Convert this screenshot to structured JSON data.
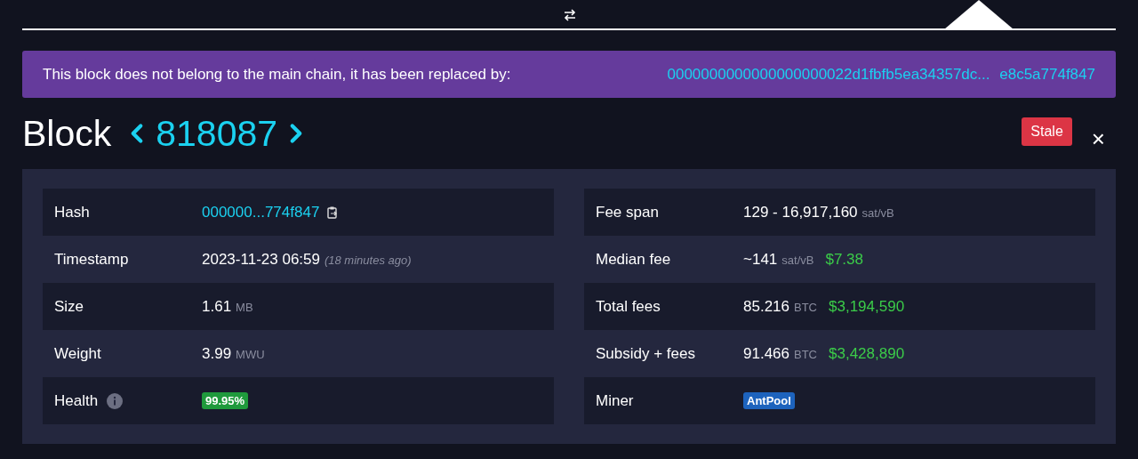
{
  "banner": {
    "message": "This block does not belong to the main chain, it has been replaced by:",
    "link": "0000000000000000000022d1fbfb5ea34357dc... e8c5a774f847"
  },
  "header": {
    "title": "Block",
    "number": "818087",
    "status": "Stale",
    "close": "×"
  },
  "columns": [
    {
      "rows": [
        {
          "label": "Hash",
          "kind": "hash",
          "value": "000000...774f847"
        },
        {
          "label": "Timestamp",
          "kind": "text",
          "value": "2023-11-23 06:59",
          "note": "(18 minutes ago)"
        },
        {
          "label": "Size",
          "kind": "text",
          "value": "1.61",
          "unit": "MB"
        },
        {
          "label": "Weight",
          "kind": "text",
          "value": "3.99",
          "unit": "MWU"
        },
        {
          "label": "Health",
          "kind": "badge",
          "info": true,
          "value": "99.95%",
          "color": "#1f9a3c"
        }
      ]
    },
    {
      "rows": [
        {
          "label": "Fee span",
          "kind": "text",
          "value": "129 - 16,917,160",
          "unit": "sat/vB"
        },
        {
          "label": "Median fee",
          "kind": "text",
          "value": "~141",
          "unit": "sat/vB",
          "fiat": "$7.38"
        },
        {
          "label": "Total fees",
          "kind": "text",
          "value": "85.216",
          "unit": "BTC",
          "fiat": "$3,194,590"
        },
        {
          "label": "Subsidy + fees",
          "kind": "text",
          "value": "91.466",
          "unit": "BTC",
          "fiat": "$3,428,890"
        },
        {
          "label": "Miner",
          "kind": "badge",
          "value": "AntPool",
          "color": "#1d63bd"
        }
      ]
    }
  ]
}
